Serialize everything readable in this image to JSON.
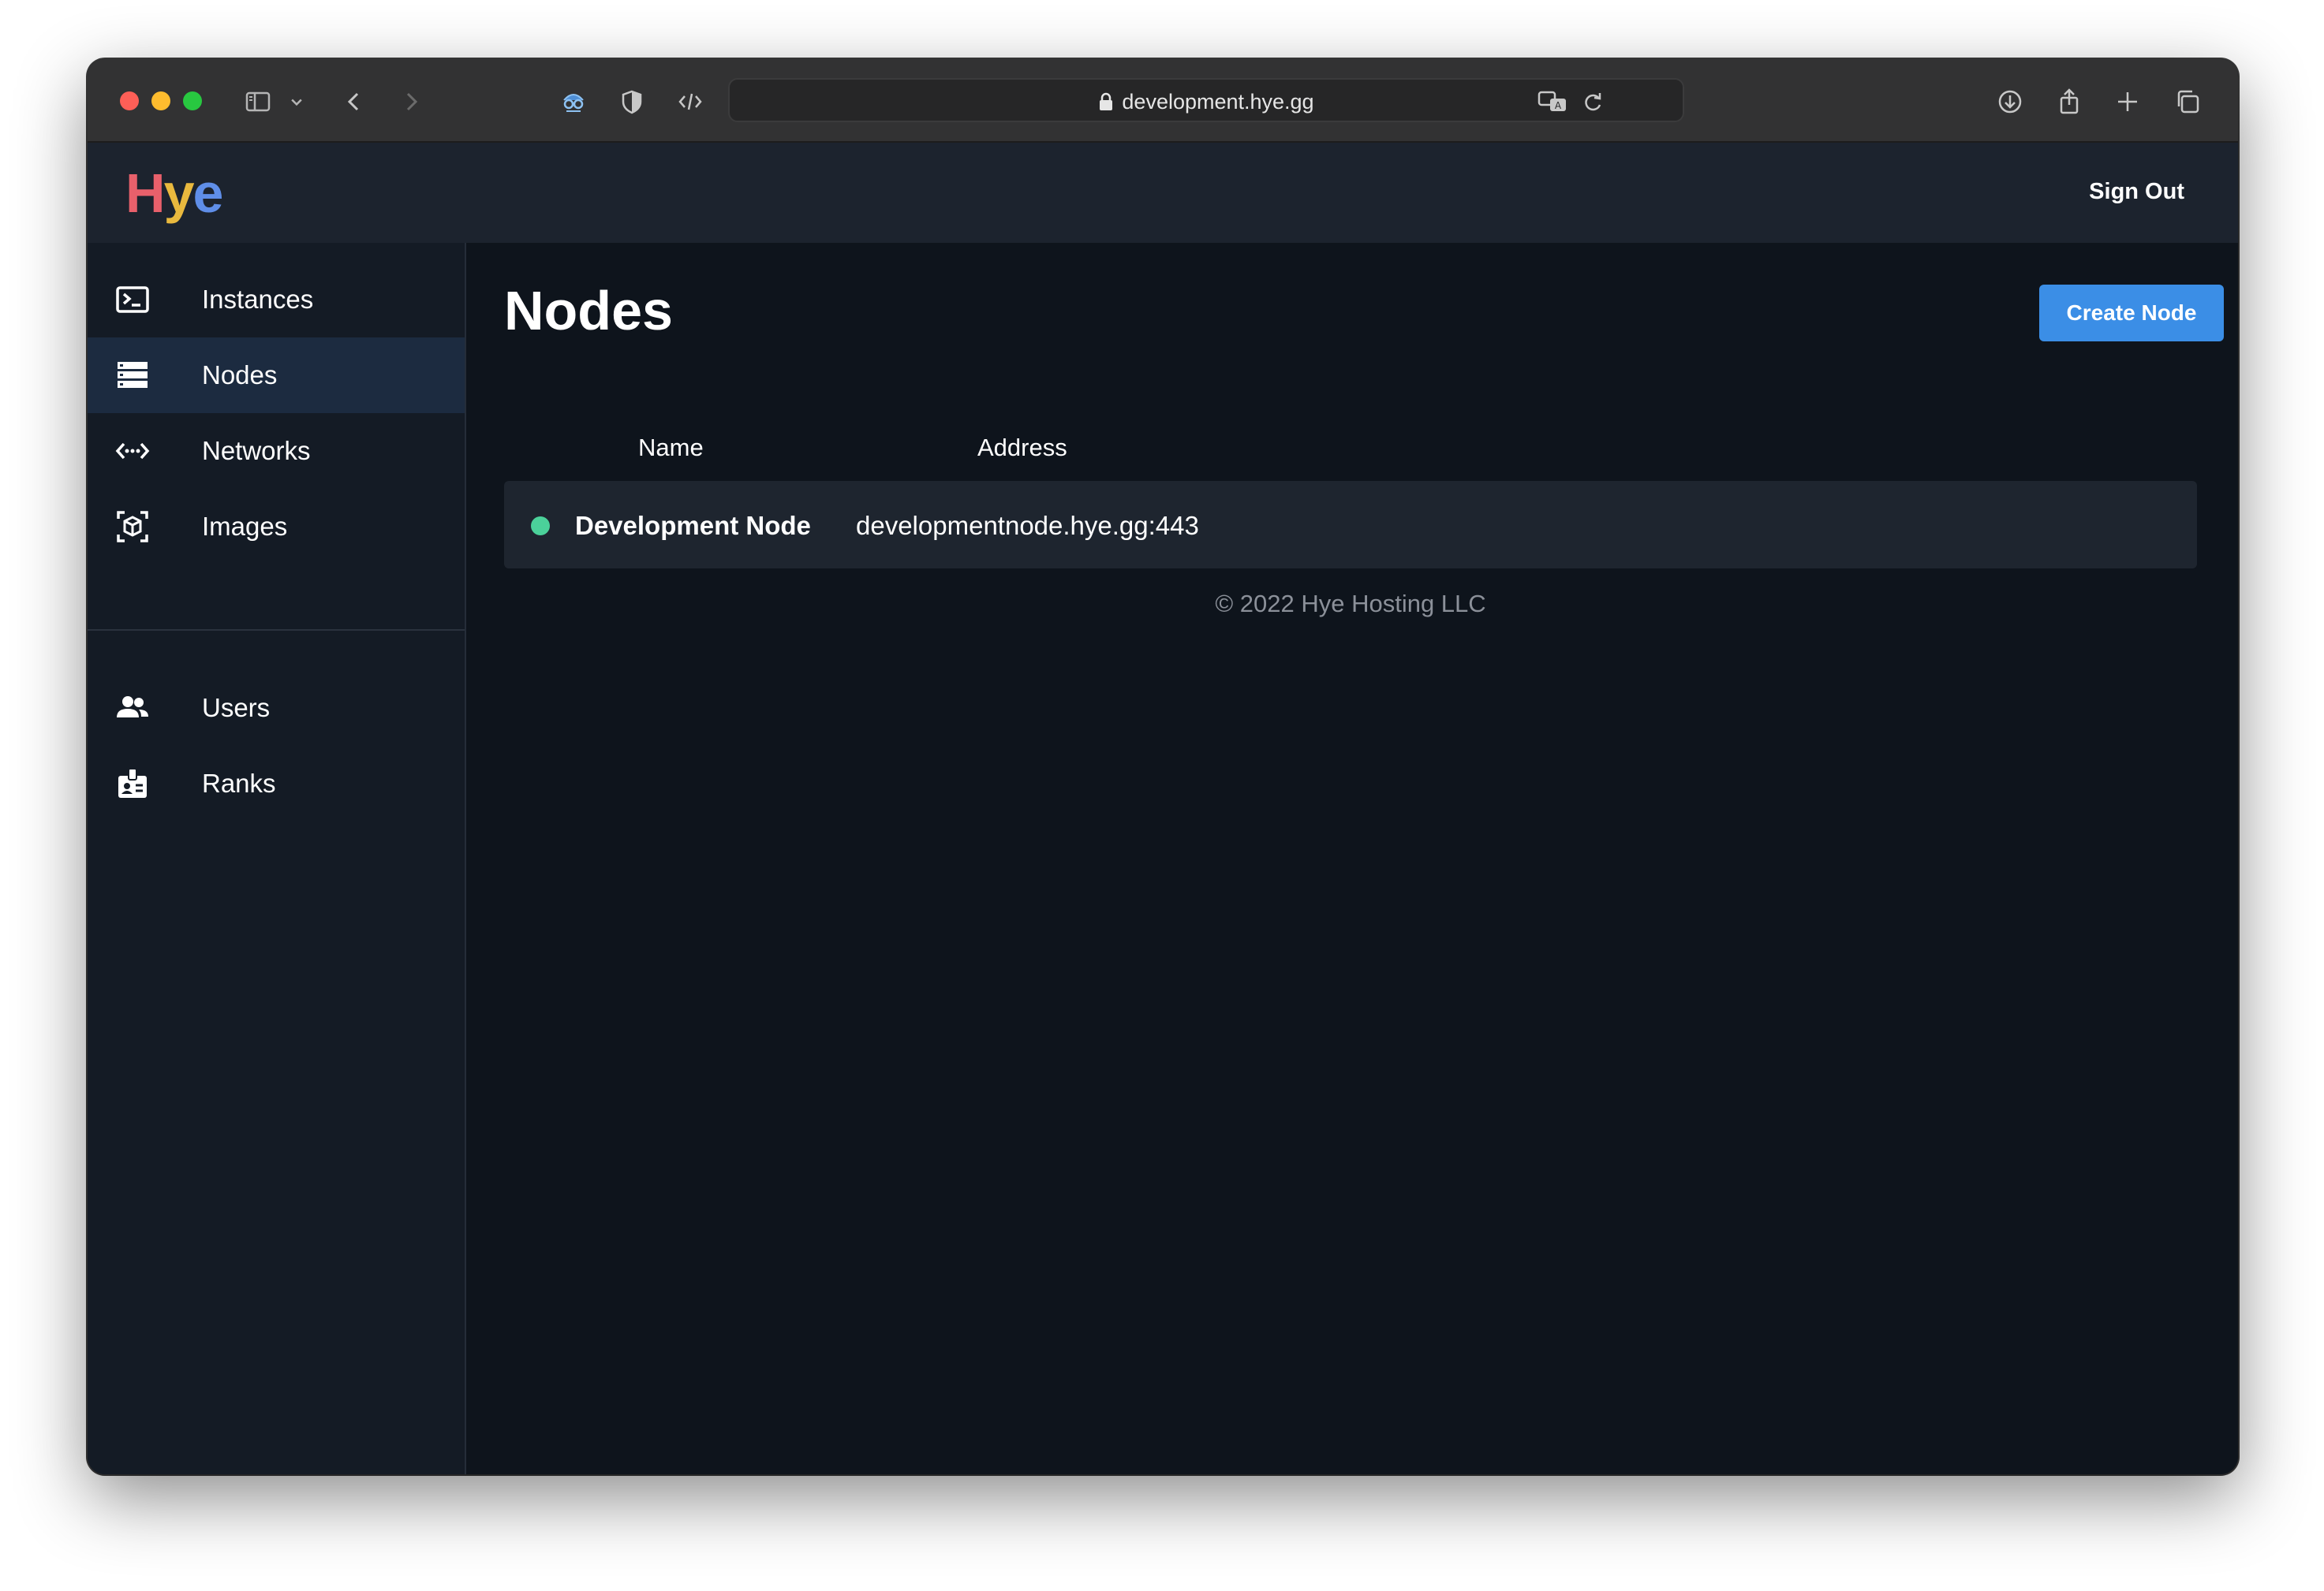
{
  "browser": {
    "url": "development.hye.gg",
    "icons": [
      "sidebar-toggle-icon",
      "chevron-down-icon",
      "back-icon",
      "forward-icon",
      "privacy-mask-icon",
      "shield-icon",
      "code-icon",
      "translate-icon",
      "reload-icon",
      "download-icon",
      "share-icon",
      "new-tab-icon",
      "tab-overview-icon"
    ]
  },
  "header": {
    "logo": {
      "h": "H",
      "y": "y",
      "e": "e"
    },
    "signout_label": "Sign Out"
  },
  "sidebar": {
    "items": [
      {
        "label": "Instances",
        "icon": "terminal-icon"
      },
      {
        "label": "Nodes",
        "icon": "server-icon",
        "active": true
      },
      {
        "label": "Networks",
        "icon": "network-icon"
      },
      {
        "label": "Images",
        "icon": "cube-icon"
      },
      {
        "label": "Users",
        "icon": "users-icon"
      },
      {
        "label": "Ranks",
        "icon": "badge-icon"
      }
    ]
  },
  "main": {
    "title": "Nodes",
    "create_label": "Create Node",
    "columns": [
      "Name",
      "Address"
    ],
    "nodes": [
      {
        "name": "Development Node",
        "address": "developmentnode.hye.gg:443",
        "status_color": "#4bd19a"
      }
    ],
    "footer": "© 2022 Hye Hosting LLC"
  },
  "colors": {
    "accent": "#3b8ee6",
    "status_online": "#4bd19a",
    "background": "#0e141c",
    "sidebar": "#141b25",
    "active_nav": "#1c2b40"
  }
}
